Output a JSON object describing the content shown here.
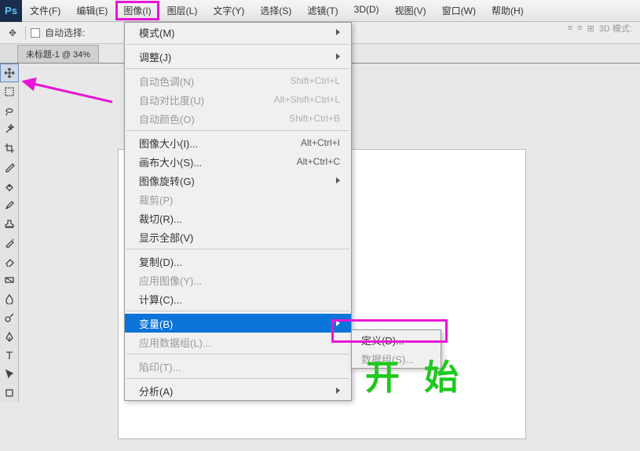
{
  "app": {
    "logo": "Ps"
  },
  "menubar": {
    "items": [
      "文件(F)",
      "编辑(E)",
      "图像(I)",
      "图层(L)",
      "文字(Y)",
      "选择(S)",
      "滤镜(T)",
      "3D(D)",
      "视图(V)",
      "窗口(W)",
      "帮助(H)"
    ],
    "highlight_index": 2
  },
  "toolbar": {
    "auto_select_label": "自动选择:",
    "mode3d_label": "3D 模式:"
  },
  "doc_tab": {
    "title": "未标题-1 @ 34%"
  },
  "dropdown": {
    "groups": [
      [
        {
          "label": "模式(M)",
          "shortcut": "",
          "submenu": true
        }
      ],
      [
        {
          "label": "调整(J)",
          "shortcut": "",
          "submenu": true
        }
      ],
      [
        {
          "label": "自动色调(N)",
          "shortcut": "Shift+Ctrl+L",
          "disabled": true
        },
        {
          "label": "自动对比度(U)",
          "shortcut": "Alt+Shift+Ctrl+L",
          "disabled": true
        },
        {
          "label": "自动颜色(O)",
          "shortcut": "Shift+Ctrl+B",
          "disabled": true
        }
      ],
      [
        {
          "label": "图像大小(I)...",
          "shortcut": "Alt+Ctrl+I"
        },
        {
          "label": "画布大小(S)...",
          "shortcut": "Alt+Ctrl+C"
        },
        {
          "label": "图像旋转(G)",
          "shortcut": "",
          "submenu": true
        },
        {
          "label": "裁剪(P)",
          "shortcut": "",
          "disabled": true
        },
        {
          "label": "裁切(R)..."
        },
        {
          "label": "显示全部(V)"
        }
      ],
      [
        {
          "label": "复制(D)..."
        },
        {
          "label": "应用图像(Y)...",
          "disabled": true
        },
        {
          "label": "计算(C)..."
        }
      ],
      [
        {
          "label": "变量(B)",
          "submenu": true,
          "selected": true
        },
        {
          "label": "应用数据组(L)...",
          "disabled": true
        }
      ],
      [
        {
          "label": "陷印(T)...",
          "disabled": true
        }
      ],
      [
        {
          "label": "分析(A)",
          "submenu": true
        }
      ]
    ]
  },
  "submenu": {
    "items": [
      {
        "label": "定义(D)..."
      },
      {
        "label": "数据组(S)...",
        "disabled": true
      }
    ]
  },
  "annotation": {
    "kaishi": "开 始"
  },
  "tool_icons": [
    "move",
    "marquee",
    "lasso",
    "wand",
    "crop",
    "eyedropper",
    "heal",
    "brush",
    "stamp",
    "history",
    "eraser",
    "gradient",
    "blur",
    "dodge",
    "pen",
    "type",
    "arrow",
    "rect"
  ]
}
